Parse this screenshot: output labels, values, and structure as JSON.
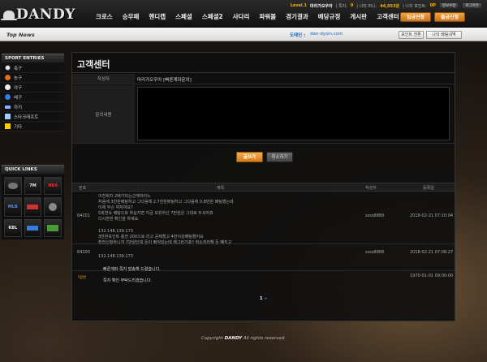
{
  "header": {
    "logo_text": "DANDY",
    "level": "Level.1",
    "user_name": "마리가오우아",
    "bonus_label": "| 쪽지:",
    "bonus_count": "0",
    "money_label": "| 나의 머니:",
    "money_value": "44,053원",
    "point_label": "| 나의 포인트:",
    "point_value": "0P",
    "info_btn": "정보수정",
    "logout_btn": "로그아웃",
    "nav": [
      "크로스",
      "승무패",
      "핸디캡",
      "스페셜",
      "스페셜2",
      "사다리",
      "파워볼",
      "경기결과",
      "배당규정",
      "게시판",
      "고객센터"
    ],
    "deposit_btn": "입금신청",
    "withdraw_btn": "출금신청"
  },
  "newsbar": {
    "title": "Top News",
    "domain_label": "도메인 :",
    "domain_value": "dan-dysin.com",
    "point_btn": "포인트 전환",
    "bets_btn": "나의 배팅내역"
  },
  "sidebar": {
    "sport_title": "SPORT ENTRIES",
    "sports": [
      {
        "label": "축구",
        "color": "#f0f0f0"
      },
      {
        "label": "농구",
        "color": "#e07020"
      },
      {
        "label": "야구",
        "color": "#eeeeee"
      },
      {
        "label": "배구",
        "color": "#3a7be0"
      },
      {
        "label": "하키",
        "color": "#8fb0ff"
      },
      {
        "label": "스타크래프트",
        "color": "#a0d0ff"
      },
      {
        "label": "기타",
        "color": "#ffcc00"
      }
    ],
    "quick_title": "QUICK LINKS",
    "quick_links": [
      "",
      "7M",
      "NBA",
      "MLB",
      "",
      "",
      "KBL",
      "",
      ""
    ]
  },
  "panel": {
    "title": "고객센터",
    "author_label": "작성자",
    "author_value": "마리가오우아  [빠른계좌문의]",
    "content_label": "문의내용",
    "write_btn": "글쓰기",
    "cancel_btn": "취소하기",
    "columns": {
      "no": "번호",
      "subject": "제목",
      "author": "작성자",
      "date": "등록일"
    },
    "rows": [
      {
        "no": "64201",
        "lines": [
          "이천회차 2배가되는근께마러노",
          "처음에 3만원배팅하고 그다음에 2.7만원배팅하고 그다음에 0.8만원 배팅했는데",
          "이제 무슨 여자여요?",
          "5회연속 배팅으로 하실지면 지금 보유하신 7만원은 그대로 두셔야죠",
          "다시한번 확인을 하세요."
        ],
        "author": "ssss8888",
        "date": "2018-02-21 07:10:04"
      },
      {
        "no": "64200",
        "lines": [
          "132.148.139.173",
          "3만원포인트 충전 200으로 리고 공제했고 4만이상배팅했어요",
          "환전신청하니까 7만원인데 돈이 빠져있는데 왜그런거죠? 취소처리해 돈 빼지고",
          "132.148.139.173"
        ],
        "author": "ssss8888",
        "date": "2018-02-21 07:08:27"
      },
      {
        "no": "",
        "badge": "└답변",
        "lines": [
          "빠른계좌 쪽지 발송해 드렸습니다.",
          "",
          "쪽지 확인 부탁드리겠습니다."
        ],
        "author": "",
        "date": "1970-01-01 09:00:00"
      }
    ],
    "pager": {
      "current": "1",
      "next": "▸"
    }
  },
  "footer": {
    "prefix": "Copyright ",
    "brand": "DANDY",
    "suffix": " All rights reserved."
  }
}
